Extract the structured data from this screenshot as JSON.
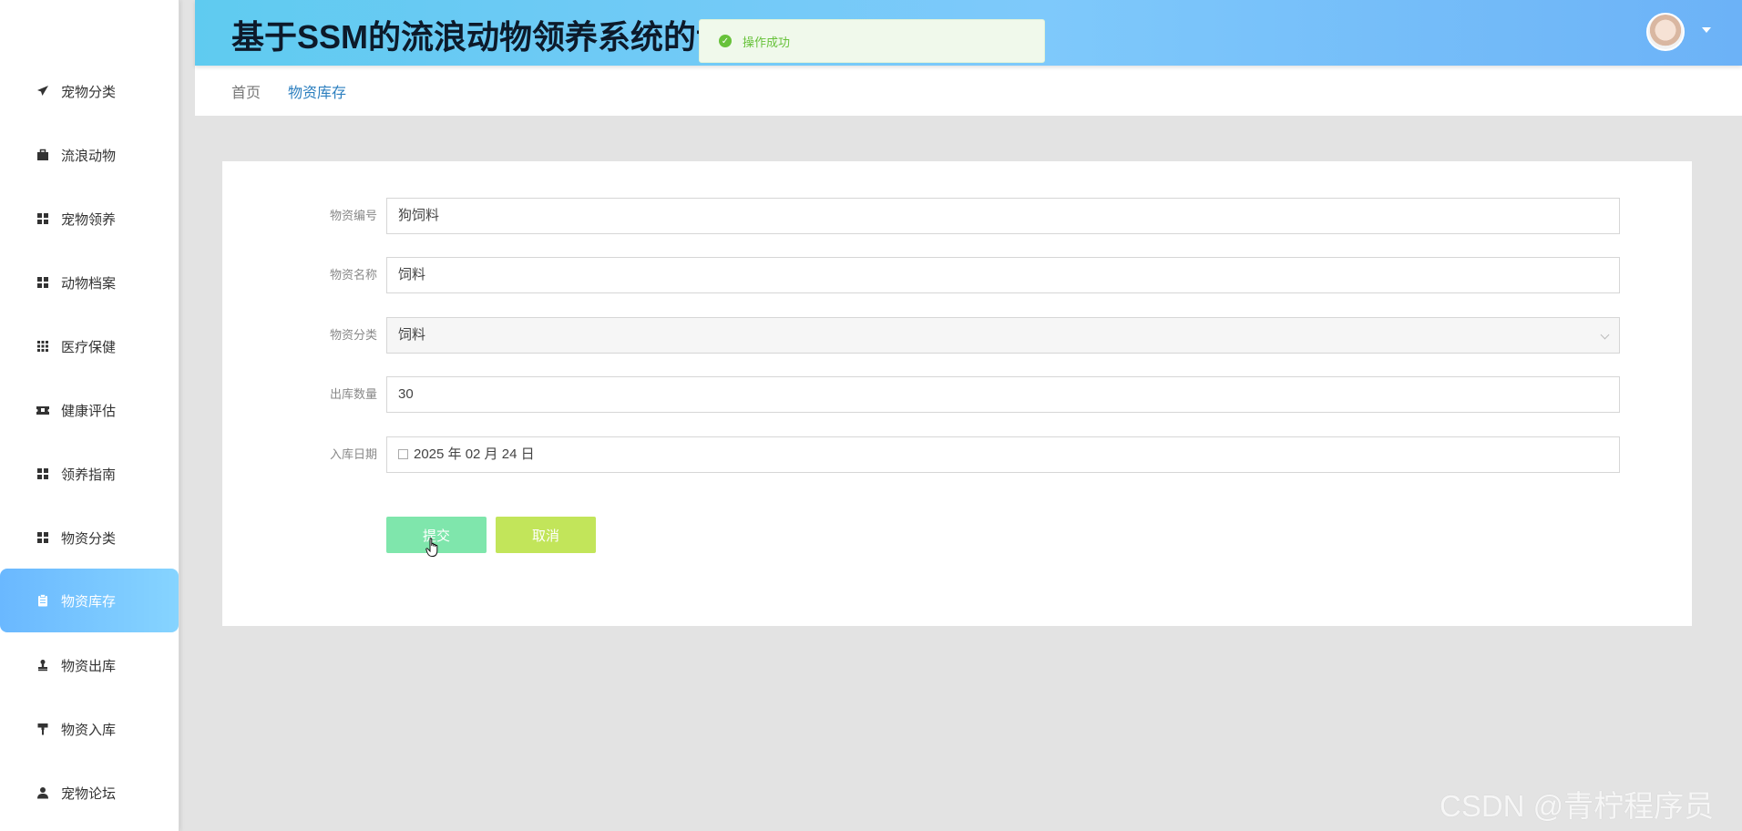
{
  "header": {
    "title": "基于SSM的流浪动物领养系统的设计与实现"
  },
  "toast": {
    "message": "操作成功",
    "icon": "check-circle-icon",
    "color": "#67c23a"
  },
  "breadcrumb": {
    "home": "首页",
    "current": "物资库存"
  },
  "sidebar": {
    "items": [
      {
        "label": "宠物分类",
        "icon": "paper-plane-icon"
      },
      {
        "label": "流浪动物",
        "icon": "briefcase-icon"
      },
      {
        "label": "宠物领养",
        "icon": "grid-icon"
      },
      {
        "label": "动物档案",
        "icon": "grid-icon"
      },
      {
        "label": "医疗保健",
        "icon": "grid-nine-icon"
      },
      {
        "label": "健康评估",
        "icon": "ticket-icon"
      },
      {
        "label": "领养指南",
        "icon": "grid-icon"
      },
      {
        "label": "物资分类",
        "icon": "grid-icon"
      },
      {
        "label": "物资库存",
        "icon": "clipboard-icon",
        "active": true
      },
      {
        "label": "物资出库",
        "icon": "stamp-icon"
      },
      {
        "label": "物资入库",
        "icon": "paint-roller-icon"
      },
      {
        "label": "宠物论坛",
        "icon": "user-icon"
      }
    ]
  },
  "form": {
    "fields": [
      {
        "label": "物资编号",
        "value": "狗饲料"
      },
      {
        "label": "物资名称",
        "value": "饲料"
      },
      {
        "label": "物资分类",
        "value": "饲料"
      },
      {
        "label": "出库数量",
        "value": "30"
      },
      {
        "label": "入库日期",
        "value": "2025 年 02 月 24 日"
      }
    ],
    "submit_label": "提交",
    "cancel_label": "取消"
  },
  "watermark": "CSDN @青柠程序员",
  "colors": {
    "accent": "#6ab8ff",
    "submit": "#7fe6ac",
    "cancel": "#c2e55a",
    "link": "#2c7fbf"
  }
}
